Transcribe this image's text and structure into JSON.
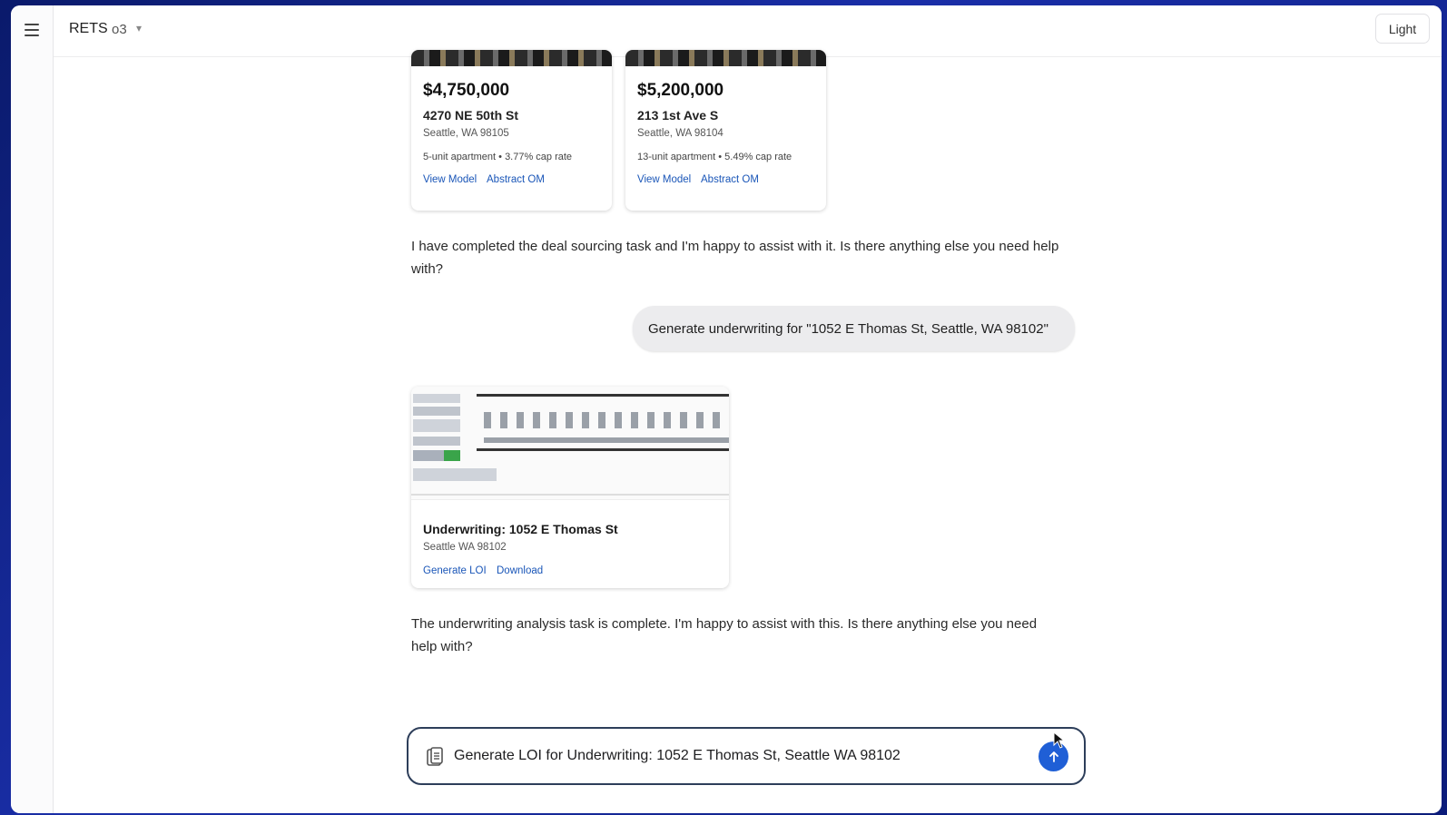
{
  "header": {
    "app_title": "RETS",
    "model": "o3",
    "model_caret": "▾",
    "theme_button": "Light"
  },
  "listings": [
    {
      "price": "$4,750,000",
      "address": "4270 NE 50th St",
      "city": "Seattle, WA 98105",
      "meta": "5-unit apartment • 3.77% cap rate",
      "link_model": "View Model",
      "link_om": "Abstract OM"
    },
    {
      "price": "$5,200,000",
      "address": "213 1st Ave S",
      "city": "Seattle, WA 98104",
      "meta": "13-unit apartment • 5.49% cap rate",
      "link_model": "View Model",
      "link_om": "Abstract OM"
    }
  ],
  "messages": {
    "assistant_1": "I have completed the deal sourcing task and I'm happy to assist with it. Is there anything else you need help with?",
    "user_1": "Generate underwriting for \"1052 E Thomas St, Seattle, WA 98102\"",
    "assistant_2": "The underwriting analysis task is complete. I'm happy to assist with this. Is there anything else you need help with?"
  },
  "underwriting_card": {
    "title": "Underwriting: 1052 E Thomas St",
    "subtitle": "Seattle WA 98102",
    "link_loi": "Generate LOI",
    "link_download": "Download"
  },
  "composer": {
    "value": "Generate LOI for Underwriting: 1052 E Thomas St, Seattle WA 98102",
    "send_icon": "arrow-up-icon"
  },
  "colors": {
    "accent": "#1f5fd6",
    "link": "#1a56b8"
  }
}
